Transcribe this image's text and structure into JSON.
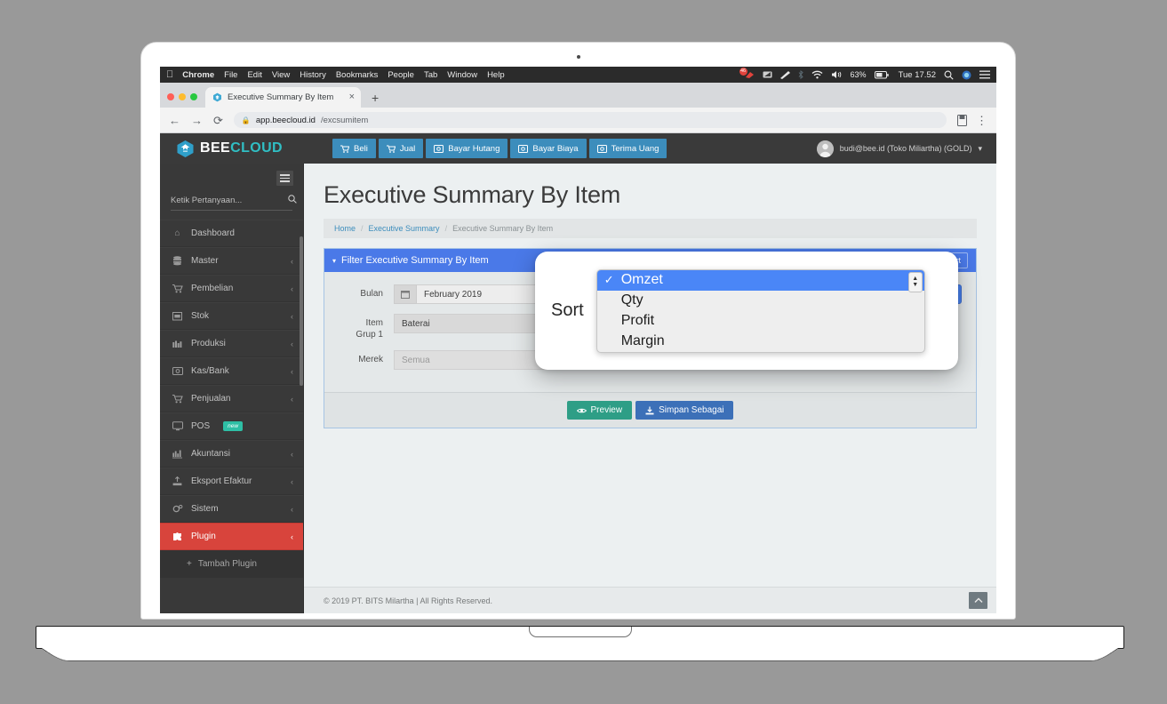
{
  "os_menubar": {
    "apple_icon": "apple-icon",
    "items": [
      {
        "label": "Chrome",
        "bold": true
      },
      {
        "label": "File",
        "bold": false
      },
      {
        "label": "Edit",
        "bold": false
      },
      {
        "label": "View",
        "bold": false
      },
      {
        "label": "History",
        "bold": false
      },
      {
        "label": "Bookmarks",
        "bold": false
      },
      {
        "label": "People",
        "bold": false
      },
      {
        "label": "Tab",
        "bold": false
      },
      {
        "label": "Window",
        "bold": false
      },
      {
        "label": "Help",
        "bold": false
      }
    ],
    "status": {
      "notification_count": "46",
      "battery_percent": "63%",
      "clock": "Tue 17.52"
    }
  },
  "browser": {
    "tab": {
      "title": "Executive Summary By Item",
      "close_label": "×",
      "new_tab_label": "+"
    },
    "omnibox": {
      "host": "app.beecloud.id",
      "path": "/excsumitem",
      "lock_icon": "lock-icon"
    },
    "back_label": "←",
    "forward_label": "→",
    "reload_label": "⟳",
    "menu_label": "⋮",
    "profile_icon": "reading-list-icon"
  },
  "app": {
    "logo": {
      "primary": "BEE",
      "secondary": "CLOUD"
    },
    "nav_buttons": [
      {
        "label": "Beli",
        "icon": "cart-icon"
      },
      {
        "label": "Jual",
        "icon": "cart-icon"
      },
      {
        "label": "Bayar Hutang",
        "icon": "money-icon"
      },
      {
        "label": "Bayar Biaya",
        "icon": "money-icon"
      },
      {
        "label": "Terima Uang",
        "icon": "money-icon"
      }
    ],
    "user": {
      "label": "budi@bee.id (Toko Miliartha) (GOLD)",
      "caret": "▾"
    }
  },
  "sidebar": {
    "search_placeholder": "Ketik Pertanyaan...",
    "search_value": "",
    "items": [
      {
        "label": "Dashboard",
        "icon": "home-icon",
        "caret": "",
        "active": false
      },
      {
        "label": "Master",
        "icon": "database-icon",
        "caret": "‹",
        "active": false
      },
      {
        "label": "Pembelian",
        "icon": "cart-icon",
        "caret": "‹",
        "active": false
      },
      {
        "label": "Stok",
        "icon": "box-icon",
        "caret": "‹",
        "active": false
      },
      {
        "label": "Produksi",
        "icon": "factory-icon",
        "caret": "‹",
        "active": false
      },
      {
        "label": "Kas/Bank",
        "icon": "money-icon",
        "caret": "‹",
        "active": false
      },
      {
        "label": "Penjualan",
        "icon": "cart-icon",
        "caret": "‹",
        "active": false
      },
      {
        "label": "POS",
        "icon": "monitor-icon",
        "caret": "",
        "badge": "new",
        "active": false
      },
      {
        "label": "Akuntansi",
        "icon": "chart-icon",
        "caret": "‹",
        "active": false
      },
      {
        "label": "Eksport Efaktur",
        "icon": "export-icon",
        "caret": "‹",
        "active": false
      },
      {
        "label": "Sistem",
        "icon": "gear-icon",
        "caret": "‹",
        "active": false
      },
      {
        "label": "Plugin",
        "icon": "puzzle-icon",
        "caret": "‹",
        "active": true
      }
    ],
    "submenu": {
      "label": "Tambah Plugin",
      "icon": "plus-icon"
    }
  },
  "page": {
    "title": "Executive Summary By Item",
    "breadcrumb": [
      {
        "label": "Home",
        "link": true
      },
      {
        "label": "Executive Summary",
        "link": true
      },
      {
        "label": "Executive Summary By Item",
        "link": false
      }
    ]
  },
  "filter_panel": {
    "header_title": "Filter Executive Summary By Item",
    "header_icon": "funnel-icon",
    "edit_template_button": {
      "label": "Edit Template Report",
      "icon": "document-icon"
    },
    "fields": {
      "bulan": {
        "label": "Bulan",
        "value": "February 2019",
        "icon": "calendar-icon"
      },
      "item_grup_1": {
        "label_line1": "Item",
        "label_line2": "Grup 1",
        "value": "Baterai",
        "search_icon": "search-icon",
        "clear_icon": "close-icon"
      },
      "merek": {
        "label": "Merek",
        "value": "Semua",
        "caret": "▾"
      },
      "sort": {
        "label": "Sort",
        "value": "Omzet",
        "check": "✓"
      }
    },
    "actions": [
      {
        "label": "Preview",
        "icon": "eye-icon",
        "style": "preview"
      },
      {
        "label": "Simpan Sebagai",
        "icon": "download-icon",
        "style": "save"
      }
    ]
  },
  "sort_dropdown": {
    "label": "Sort",
    "check_mark": "✓",
    "options": [
      {
        "label": "Omzet",
        "selected": true
      },
      {
        "label": "Qty",
        "selected": false
      },
      {
        "label": "Profit",
        "selected": false
      },
      {
        "label": "Margin",
        "selected": false
      }
    ],
    "stepper_up": "▲",
    "stepper_down": "▼"
  },
  "footer": {
    "copyright": "© 2019 PT. BITS Milartha | All Rights Reserved.",
    "scroll_top_icon": "chevron-up-icon"
  },
  "colors": {
    "accent_blue": "#4a79e8",
    "nav_blue": "#3c8dbc",
    "active_red": "#d8443c",
    "preview_green": "#2e9e86",
    "save_blue": "#3c70b8",
    "logo_teal": "#30bfc4"
  }
}
